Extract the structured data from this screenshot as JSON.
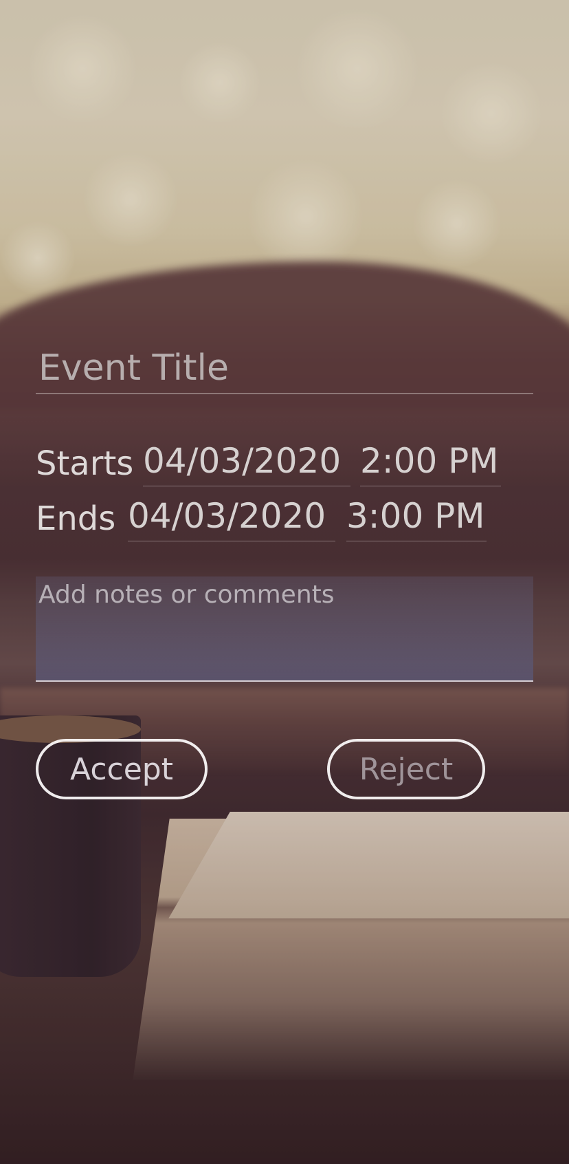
{
  "form": {
    "title_placeholder": "Event Title",
    "starts": {
      "label": "Starts",
      "date": "04/03/2020",
      "time": "2:00 PM"
    },
    "ends": {
      "label": "Ends",
      "date": "04/03/2020",
      "time": "3:00 PM"
    },
    "notes_placeholder": "Add notes or comments"
  },
  "actions": {
    "accept_label": "Accept",
    "reject_label": "Reject"
  },
  "colors": {
    "button_border": "#faf8f8",
    "text_light": "#ded9d8",
    "notes_background": "#5a5878"
  },
  "background": {
    "description_icon": "coffee-and-book-photo"
  }
}
